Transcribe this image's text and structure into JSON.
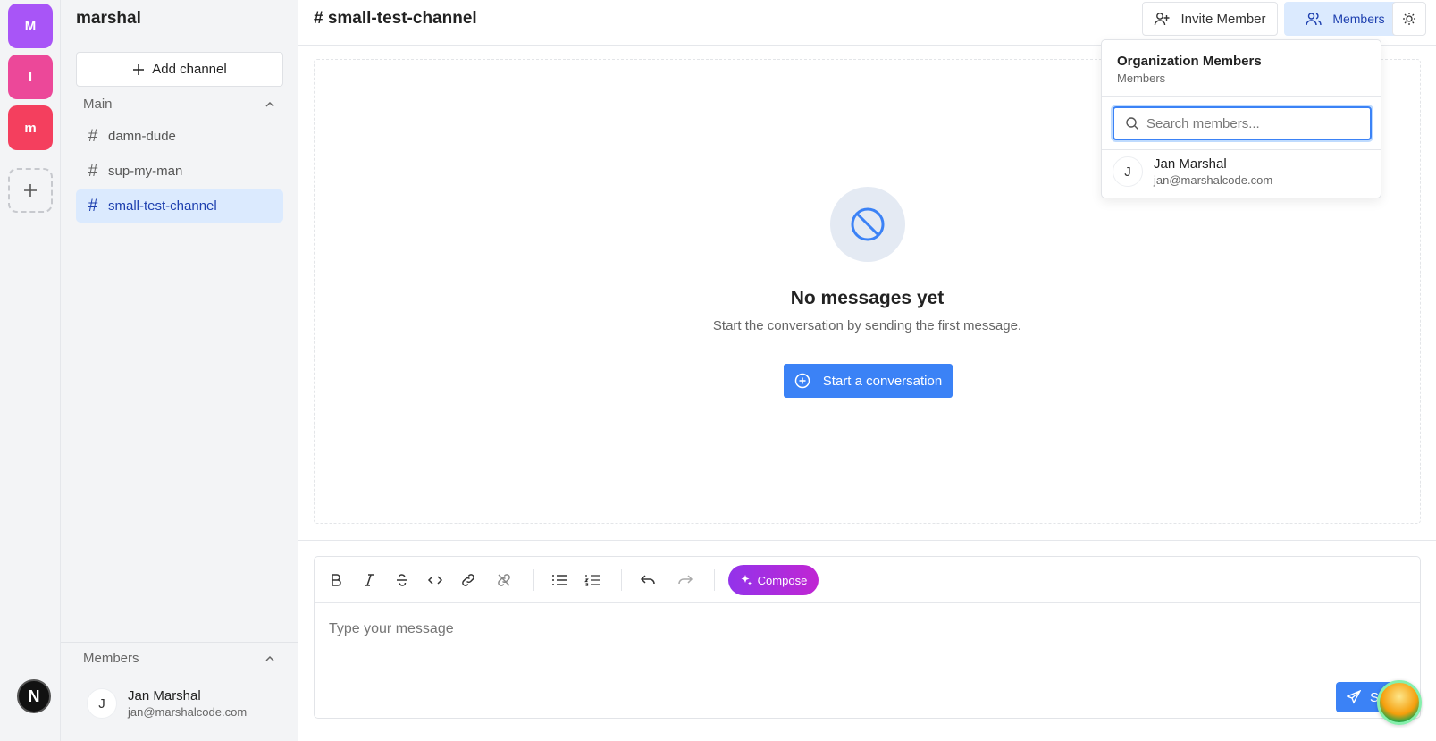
{
  "workspaces": [
    {
      "label": "M",
      "color": "#a855f7"
    },
    {
      "label": "I",
      "color": "#ec4899"
    },
    {
      "label": "m",
      "color": "#f43f5e"
    }
  ],
  "rail_logo": "N",
  "sidebar": {
    "org_name": "marshal",
    "add_channel_label": "Add channel",
    "main_section_label": "Main",
    "channels": [
      {
        "name": "damn-dude",
        "active": false
      },
      {
        "name": "sup-my-man",
        "active": false
      },
      {
        "name": "small-test-channel",
        "active": true
      }
    ],
    "members_section_label": "Members",
    "members": [
      {
        "initial": "J",
        "name": "Jan Marshal",
        "email": "jan@marshalcode.com"
      }
    ]
  },
  "header": {
    "channel_title": "# small-test-channel",
    "invite_label": "Invite Member",
    "members_label": "Members"
  },
  "empty_state": {
    "title": "No messages yet",
    "subtitle": "Start the conversation by sending the first message.",
    "button_label": "Start a conversation"
  },
  "composer": {
    "compose_label": "Compose",
    "placeholder": "Type your message",
    "send_label": "Send"
  },
  "members_popover": {
    "title": "Organization Members",
    "subtitle": "Members",
    "search_placeholder": "Search members...",
    "members": [
      {
        "initial": "J",
        "name": "Jan Marshal",
        "email": "jan@marshalcode.com"
      }
    ]
  },
  "colors": {
    "accent": "#3b82f6",
    "active_bg": "#dbeafe",
    "active_text": "#1e40af",
    "compose_gradient_start": "#9333ea",
    "compose_gradient_end": "#c026d3"
  }
}
